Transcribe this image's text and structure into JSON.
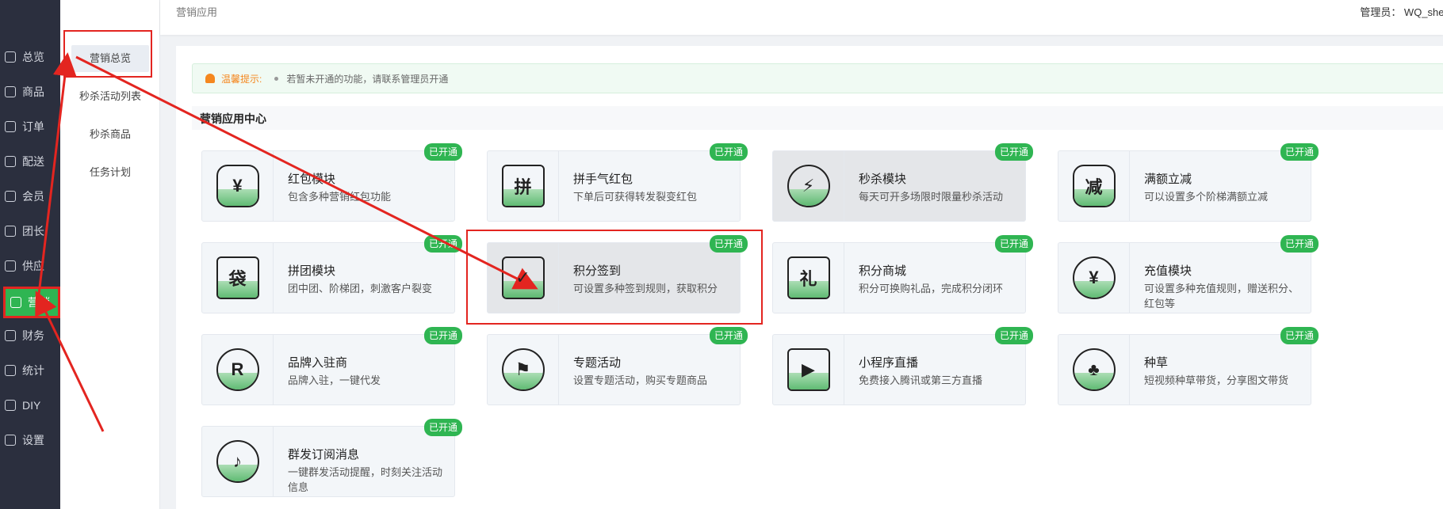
{
  "header": {
    "breadcrumb": "营销应用",
    "admin": "管理员： WQ_shec"
  },
  "sidebar": {
    "items": [
      {
        "label": "总览",
        "icon": "home-icon"
      },
      {
        "label": "商品",
        "icon": "goods-icon"
      },
      {
        "label": "订单",
        "icon": "order-icon"
      },
      {
        "label": "配送",
        "icon": "delivery-icon"
      },
      {
        "label": "会员",
        "icon": "member-icon"
      },
      {
        "label": "团长",
        "icon": "leader-icon"
      },
      {
        "label": "供应",
        "icon": "supply-icon"
      },
      {
        "label": "营销",
        "icon": "gift-icon"
      },
      {
        "label": "财务",
        "icon": "finance-icon"
      },
      {
        "label": "统计",
        "icon": "stats-icon"
      },
      {
        "label": "DIY",
        "icon": "diy-icon"
      },
      {
        "label": "设置",
        "icon": "gear-icon"
      }
    ]
  },
  "submenu": {
    "items": [
      "营销总览",
      "秒杀活动列表",
      "秒杀商品",
      "任务计划"
    ]
  },
  "notice": {
    "title": "温馨提示:",
    "text": "若暂未开通的功能，请联系管理员开通"
  },
  "section_title": "营销应用中心",
  "badge_label": "已开通",
  "cards": [
    {
      "title": "红包模块",
      "desc": "包含多种营销红包功能",
      "glyph": "¥"
    },
    {
      "title": "拼手气红包",
      "desc": "下单后可获得转发裂变红包",
      "glyph": "拼"
    },
    {
      "title": "秒杀模块",
      "desc": "每天可开多场限时限量秒杀活动",
      "glyph": "⚡"
    },
    {
      "title": "满额立减",
      "desc": "可以设置多个阶梯满额立减",
      "glyph": "减"
    },
    {
      "title": "拼团模块",
      "desc": "团中团、阶梯团，刺激客户裂变",
      "glyph": "袋"
    },
    {
      "title": "积分签到",
      "desc": "可设置多种签到规则，获取积分",
      "glyph": "✓"
    },
    {
      "title": "积分商城",
      "desc": "积分可换购礼品，完成积分闭环",
      "glyph": "礼"
    },
    {
      "title": "充值模块",
      "desc": "可设置多种充值规则，赠送积分、红包等",
      "glyph": "¥"
    },
    {
      "title": "品牌入驻商",
      "desc": "品牌入驻，一键代发",
      "glyph": "R"
    },
    {
      "title": "专题活动",
      "desc": "设置专题活动，购买专题商品",
      "glyph": "⚑"
    },
    {
      "title": "小程序直播",
      "desc": "免费接入腾讯或第三方直播",
      "glyph": "▶"
    },
    {
      "title": "种草",
      "desc": "短视频种草带货，分享图文带货",
      "glyph": "♣"
    },
    {
      "title": "群发订阅消息",
      "desc": "一键群发活动提醒，时刻关注活动信息",
      "glyph": "♪"
    }
  ]
}
